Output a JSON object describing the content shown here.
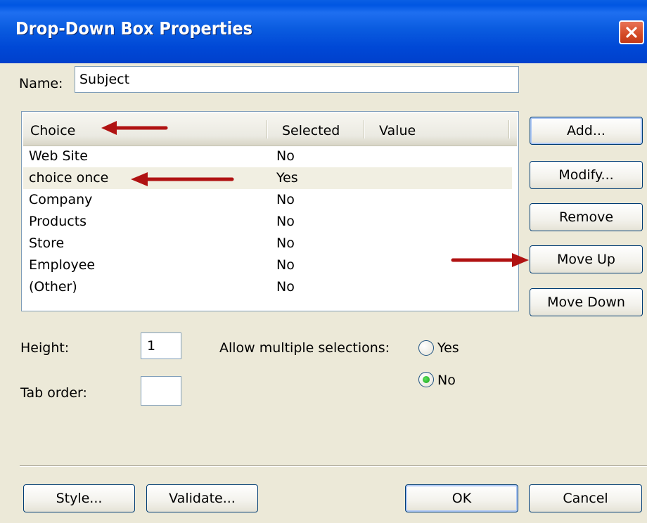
{
  "window": {
    "title": "Drop-Down Box Properties",
    "close_icon": "close-icon"
  },
  "name_field": {
    "label": "Name:",
    "value": "Subject"
  },
  "choice_list": {
    "columns": [
      "Choice",
      "Selected",
      "Value"
    ],
    "rows": [
      {
        "choice": "Web Site",
        "selected": "No",
        "value": ""
      },
      {
        "choice": "choice once",
        "selected": "Yes",
        "value": ""
      },
      {
        "choice": "Company",
        "selected": "No",
        "value": ""
      },
      {
        "choice": "Products",
        "selected": "No",
        "value": ""
      },
      {
        "choice": "Store",
        "selected": "No",
        "value": ""
      },
      {
        "choice": "Employee",
        "selected": "No",
        "value": ""
      },
      {
        "choice": "(Other)",
        "selected": "No",
        "value": ""
      }
    ],
    "highlighted_row": 1
  },
  "side_buttons": {
    "add": "Add...",
    "modify": "Modify...",
    "remove": "Remove",
    "move_up": "Move Up",
    "move_down": "Move Down"
  },
  "height": {
    "label": "Height:",
    "value": "1"
  },
  "tab_order": {
    "label": "Tab order:",
    "value": ""
  },
  "allow_multiple": {
    "label": "Allow multiple selections:",
    "options": [
      "Yes",
      "No"
    ],
    "selected": "No"
  },
  "bottom_buttons": {
    "style": "Style...",
    "validate": "Validate...",
    "ok": "OK",
    "cancel": "Cancel"
  },
  "colors": {
    "titlebar": "#0a5ce0",
    "dialog_bg": "#ece9d8",
    "close_button": "#d44a26",
    "annotation_arrow": "#b01212",
    "radio_selected": "#17a317"
  }
}
